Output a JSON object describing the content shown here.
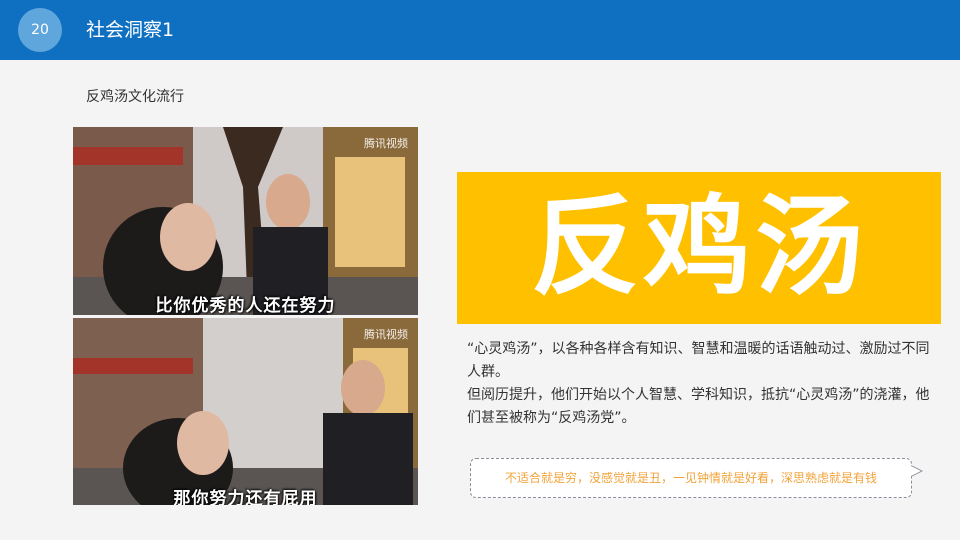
{
  "header": {
    "page_number": "20",
    "title": "社会洞察1"
  },
  "subtitle": "反鸡汤文化流行",
  "photos": [
    {
      "caption": "比你优秀的人还在努力",
      "watermark": "腾讯视频"
    },
    {
      "caption": "那你努力还有屁用",
      "watermark": "腾讯视频"
    }
  ],
  "banner": {
    "text": "反鸡汤",
    "color": "#ffc000"
  },
  "body": {
    "paragraph1": "“心灵鸡汤”，以各种各样含有知识、智慧和温暖的话语触动过、激励过不同人群。",
    "paragraph2": "但阅历提升，他们开始以个人智慧、学科知识，抵抗“心灵鸡汤”的浇灌，他们甚至被称为“反鸡汤党”。"
  },
  "quote": "不适合就是穷，没感觉就是丑，一见钟情就是好看，深思熟虑就是有钱",
  "colors": {
    "header": "#0f6fc0",
    "badge": "#5fa6dc",
    "quote_text": "#f2a33a"
  }
}
